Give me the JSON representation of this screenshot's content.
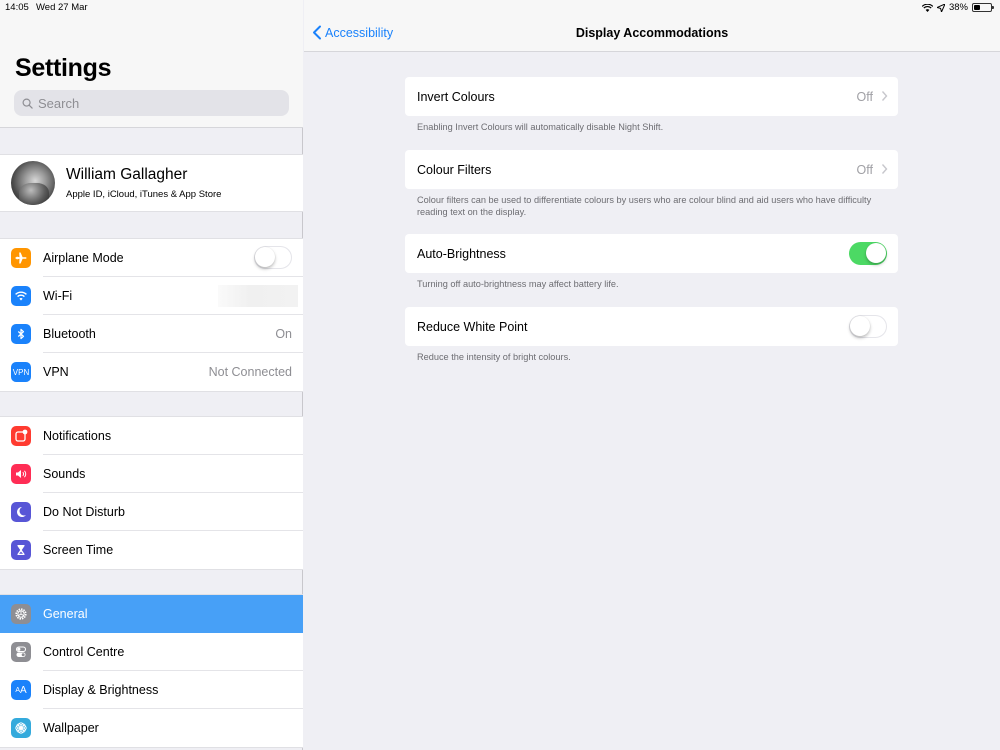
{
  "status_bar": {
    "time": "14:05",
    "date": "Wed 27 Mar",
    "battery_text": "38%",
    "battery_level": 0.38
  },
  "sidebar": {
    "title": "Settings",
    "search_placeholder": "Search",
    "profile": {
      "name": "William Gallagher",
      "subtitle": "Apple ID, iCloud, iTunes & App Store"
    },
    "groups": [
      {
        "items": [
          {
            "label": "Airplane Mode",
            "icon": "airplane-icon",
            "color": "#ff9500",
            "control": "toggle",
            "on": false
          },
          {
            "label": "Wi-Fi",
            "icon": "wifi-icon",
            "color": "#1a82fb",
            "value": ""
          },
          {
            "label": "Bluetooth",
            "icon": "bluetooth-icon",
            "color": "#1a82fb",
            "value": "On"
          },
          {
            "label": "VPN",
            "icon": "vpn-icon",
            "color": "#1a82fb",
            "value": "Not Connected",
            "icon_text": "VPN"
          }
        ]
      },
      {
        "items": [
          {
            "label": "Notifications",
            "icon": "notifications-icon",
            "color": "#ff3b30"
          },
          {
            "label": "Sounds",
            "icon": "sounds-icon",
            "color": "#ff2d55"
          },
          {
            "label": "Do Not Disturb",
            "icon": "moon-icon",
            "color": "#5856d6"
          },
          {
            "label": "Screen Time",
            "icon": "hourglass-icon",
            "color": "#5856d6"
          }
        ]
      },
      {
        "items": [
          {
            "label": "General",
            "icon": "gear-icon",
            "color": "#8e8e93",
            "selected": true
          },
          {
            "label": "Control Centre",
            "icon": "control-centre-icon",
            "color": "#8e8e93"
          },
          {
            "label": "Display & Brightness",
            "icon": "display-brightness-icon",
            "color": "#1a82fb",
            "icon_text": "AA"
          },
          {
            "label": "Wallpaper",
            "icon": "wallpaper-icon",
            "color": "#34aadc"
          }
        ]
      }
    ]
  },
  "detail": {
    "back_label": "Accessibility",
    "title": "Display Accommodations",
    "cells": [
      {
        "label": "Invert Colours",
        "value": "Off",
        "type": "disclosure",
        "footer": "Enabling Invert Colours will automatically disable Night Shift."
      },
      {
        "label": "Colour Filters",
        "value": "Off",
        "type": "disclosure",
        "footer": "Colour filters can be used to differentiate colours by users who are colour blind and aid users who have difficulty reading text on the display."
      },
      {
        "label": "Auto-Brightness",
        "type": "toggle",
        "on": true,
        "footer": "Turning off auto-brightness may affect battery life."
      },
      {
        "label": "Reduce White Point",
        "type": "toggle",
        "on": false,
        "footer": "Reduce the intensity of bright colours."
      }
    ]
  },
  "colors": {
    "accent": "#1a82fb",
    "selected_row": "#47a0f7",
    "toggle_on": "#4cd964"
  }
}
